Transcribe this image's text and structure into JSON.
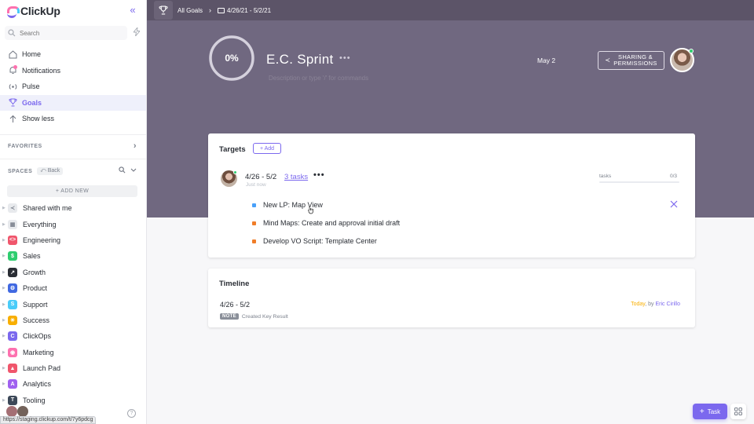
{
  "app": {
    "name": "ClickUp"
  },
  "search": {
    "placeholder": "Search"
  },
  "nav": [
    {
      "label": "Home",
      "icon": "home-icon"
    },
    {
      "label": "Notifications",
      "icon": "bell-icon"
    },
    {
      "label": "Pulse",
      "icon": "pulse-icon"
    },
    {
      "label": "Goals",
      "icon": "trophy-icon",
      "active": true
    },
    {
      "label": "Show less",
      "icon": "arrow-up-icon"
    }
  ],
  "sections": {
    "favorites": "FAVORITES",
    "spaces": "SPACES",
    "back": "Back",
    "add_new": "+ ADD NEW"
  },
  "spaces": [
    {
      "label": "Shared with me",
      "color": "#e8eaed",
      "glyph": "≺"
    },
    {
      "label": "Everything",
      "color": "#e8eaed",
      "glyph": "▦"
    },
    {
      "label": "Engineering",
      "color": "#f0566c",
      "glyph": "<>"
    },
    {
      "label": "Sales",
      "color": "#2ecd6f",
      "glyph": "$"
    },
    {
      "label": "Growth",
      "color": "#292d34",
      "glyph": "↗"
    },
    {
      "label": "Product",
      "color": "#4169e1",
      "glyph": "⚙"
    },
    {
      "label": "Support",
      "color": "#49ccf9",
      "glyph": "S"
    },
    {
      "label": "Success",
      "color": "#f8ae00",
      "glyph": "☀"
    },
    {
      "label": "ClickOps",
      "color": "#7b68ee",
      "glyph": "C"
    },
    {
      "label": "Marketing",
      "color": "#fd71af",
      "glyph": "◉"
    },
    {
      "label": "Launch Pad",
      "color": "#f0566c",
      "glyph": "▲"
    },
    {
      "label": "Analytics",
      "color": "#a060f0",
      "glyph": "A"
    },
    {
      "label": "Tooling",
      "color": "#3c4858",
      "glyph": "T"
    }
  ],
  "statusbar": {
    "url": "https://staging.clickup.com/t/7y6pdcg"
  },
  "breadcrumb": {
    "root": "All Goals",
    "folder": "4/26/21 - 5/2/21"
  },
  "goal": {
    "progress": "0%",
    "progress_value": 0,
    "title": "E.C. Sprint",
    "more": "•••",
    "description_placeholder": "Description or type '/' for commands",
    "due_date": "May 2",
    "share_line1": "SHARING &",
    "share_line2": "PERMISSIONS"
  },
  "targets": {
    "title": "Targets",
    "add_label": "+ Add",
    "key_result": {
      "dates": "4/26 - 5/2",
      "tasks_link": "3 tasks",
      "more": "•••",
      "updated": "Just now",
      "bar_label": "tasks",
      "bar_count": "0/3",
      "bar_fraction": 0
    },
    "tasks": [
      {
        "name": "New LP: Map View",
        "color": "#49a0f9"
      },
      {
        "name": "Mind Maps: Create and approval initial draft",
        "color": "#f07d28"
      },
      {
        "name": "Develop VO Script: Template Center",
        "color": "#f07d28"
      }
    ]
  },
  "timeline": {
    "title": "Timeline",
    "range": "4/26 - 5/2",
    "note_badge": "NOTE",
    "note_text": "Created Key Result",
    "today": "Today",
    "by": ", by",
    "author": "Eric Cirillo"
  },
  "fab": {
    "task_label": "Task"
  }
}
